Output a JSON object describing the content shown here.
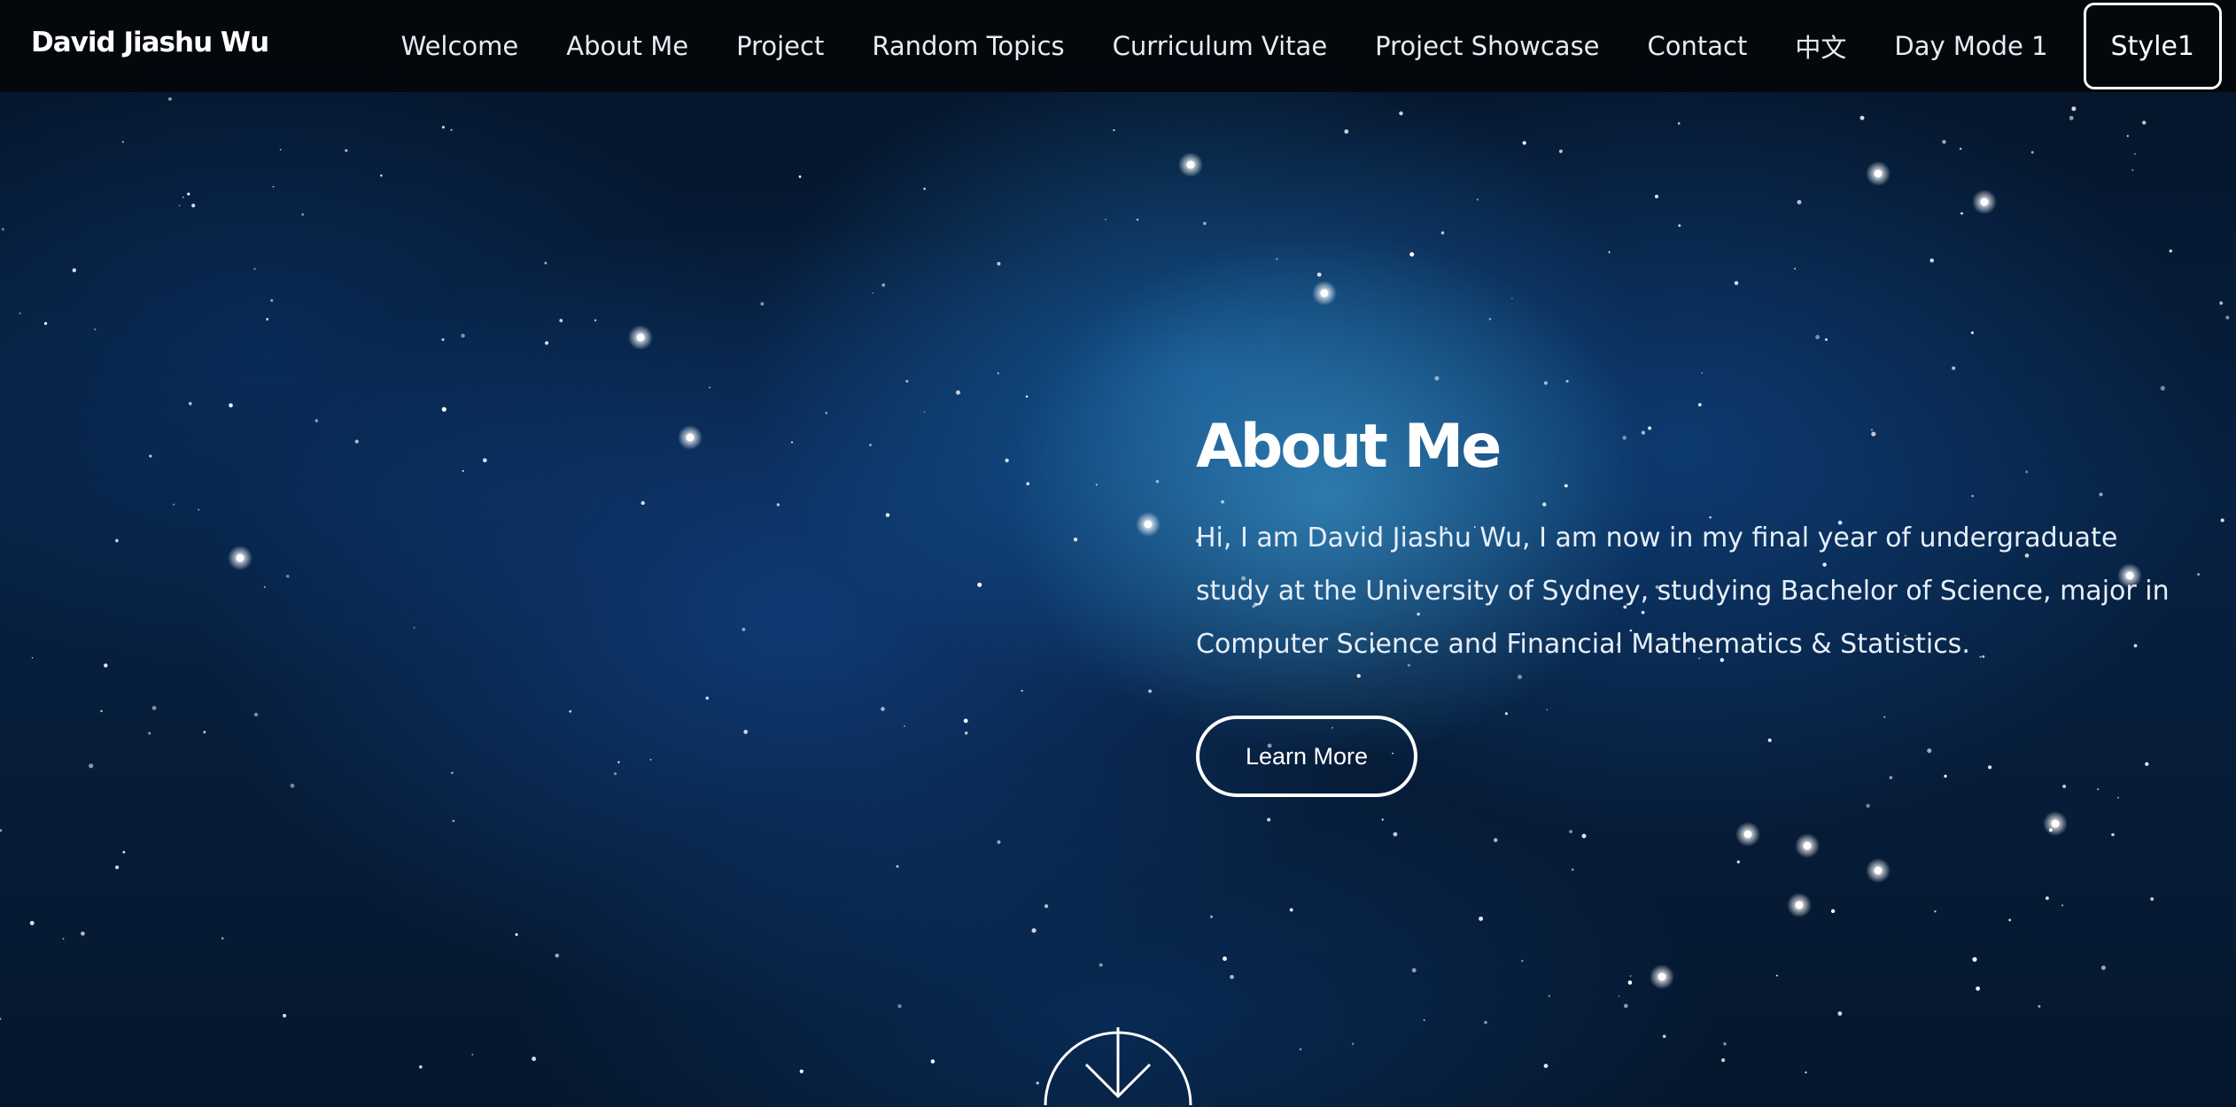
{
  "header": {
    "brand": "David Jiashu Wu",
    "nav": [
      "Welcome",
      "About Me",
      "Project",
      "Random Topics",
      "Curriculum Vitae",
      "Project Showcase",
      "Contact",
      "中文",
      "Day Mode 1"
    ],
    "style_button": "Style1"
  },
  "about": {
    "title": "About Me",
    "text": "Hi, I am David Jiashu Wu, I am now in my final year of undergraduate study at the University of Sydney, studying Bachelor of Science, major in Computer Science and Financial Mathematics & Statistics.",
    "button": "Learn More"
  },
  "icons": {
    "scroll": "arrow-down-icon"
  },
  "colors": {
    "nav_bg": "#04070c",
    "accent": "#ffffff",
    "space": "#072142"
  }
}
